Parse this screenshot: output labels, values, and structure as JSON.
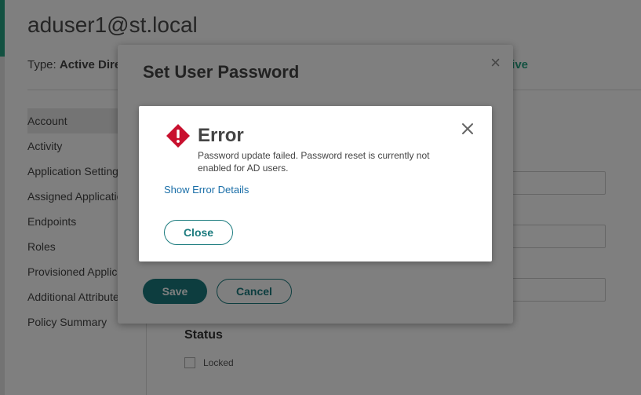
{
  "page": {
    "user_title": "aduser1@st.local",
    "type_label": "Type:",
    "type_value": "Active Directory",
    "status_value": "Active"
  },
  "sidebar": {
    "items": [
      {
        "label": "Account"
      },
      {
        "label": "Activity"
      },
      {
        "label": "Application Settings"
      },
      {
        "label": "Assigned Applications"
      },
      {
        "label": "Endpoints"
      },
      {
        "label": "Roles"
      },
      {
        "label": "Provisioned Applications"
      },
      {
        "label": "Additional Attributes"
      },
      {
        "label": "Policy Summary"
      }
    ]
  },
  "status_section": {
    "heading": "Status",
    "locked_label": "Locked"
  },
  "password_dialog": {
    "title": "Set User Password",
    "close_glyph": "×",
    "save_label": "Save",
    "cancel_label": "Cancel"
  },
  "error_dialog": {
    "title": "Error",
    "message": "Password update failed. Password reset is currently not enabled for AD users.",
    "details_link": "Show Error Details",
    "close_button": "Close"
  },
  "colors": {
    "accent": "#1b7b7e",
    "brand_green": "#27a383",
    "error_red": "#c8102e",
    "link_blue": "#1b6fa8"
  }
}
